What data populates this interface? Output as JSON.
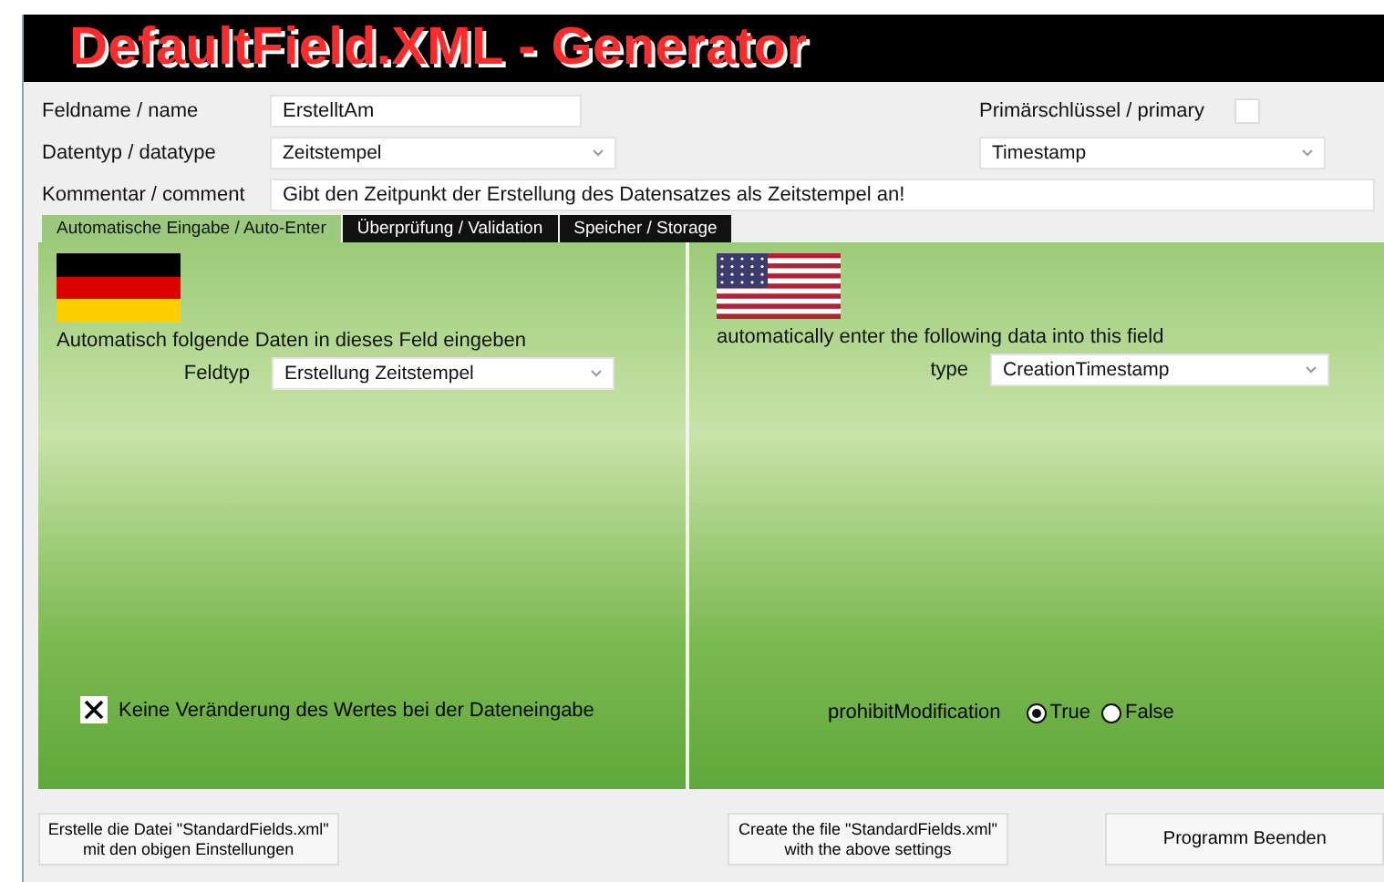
{
  "title": "DefaultField.XML - Generator",
  "fields": {
    "name": {
      "label": "Feldname / name",
      "value": "ErstelltAm"
    },
    "datatype": {
      "label": "Datentyp / datatype",
      "value": "Zeitstempel"
    },
    "comment": {
      "label": "Kommentar / comment",
      "value": "Gibt den Zeitpunkt der Erstellung des Datensatzes als Zeitstempel an!"
    },
    "primary": {
      "label": "Primärschlüssel / primary",
      "checked": false
    },
    "datatype_en": {
      "value": "Timestamp"
    }
  },
  "tabs": [
    {
      "label": "Automatische Eingabe / Auto-Enter",
      "selected": true
    },
    {
      "label": "Überprüfung / Validation",
      "selected": false
    },
    {
      "label": "Speicher / Storage",
      "selected": false
    }
  ],
  "german": {
    "heading": "Automatisch folgende Daten in dieses Feld eingeben",
    "type_label": "Feldtyp",
    "type_value": "Erstellung Zeitstempel",
    "checkbox_label": "Keine Veränderung des Wertes bei der Dateneingabe",
    "checked": true
  },
  "english": {
    "heading": "automatically enter the following data into this field",
    "type_label": "type",
    "type_value": "CreationTimestamp",
    "option_label": "prohibitModification",
    "options": [
      {
        "label": "True",
        "selected": true
      },
      {
        "label": "False",
        "selected": false
      }
    ]
  },
  "buttons": [
    {
      "label": "Erstelle die Datei \"StandardFields.xml\"\nmit den obigen Einstellungen"
    },
    {
      "label": "Create the file \"StandardFields.xml\"\nwith the above settings"
    },
    {
      "label": "Programm Beenden"
    }
  ]
}
